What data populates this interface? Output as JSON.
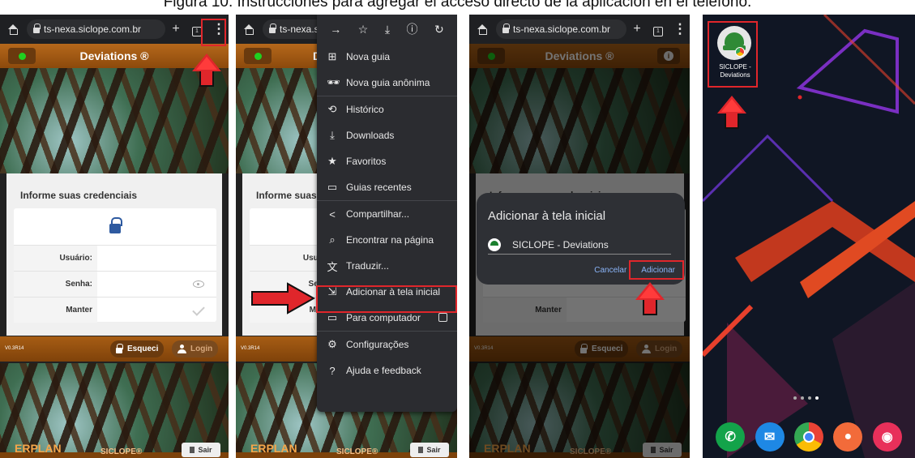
{
  "caption": "Figura 10. Instrucciones para agregar el acceso directo de la aplicación en el teléfono.",
  "browser": {
    "url_full": "ts-nexa.siclope.com.br",
    "url_short": "ts-nexa.s",
    "url_dim": "ts-nexa.siclope.com.br",
    "new_tab": "+",
    "tab_count": "1",
    "menu_dots": "⋮"
  },
  "app": {
    "title": "Deviations ®",
    "prompt": "Informe suas credenciais",
    "user_label": "Usuário:",
    "pass_label": "Senha:",
    "keep_label": "Manter",
    "version": "V0.3R14",
    "forgot_btn": "Esqueci",
    "login_btn": "Login",
    "erplan": "ERPLAN",
    "siclope": "SICLOPE®",
    "exit_btn": "Sair",
    "p2_prompt_short": "Informe suas c",
    "p2_user_short": "Usuári",
    "p2_pass_short": "Senh",
    "p2_keep_short": "Mant"
  },
  "menu": {
    "items": [
      {
        "icon": "⊞",
        "label": "Nova guia"
      },
      {
        "icon": "🕶",
        "label": "Nova guia anônima"
      },
      {
        "icon": "⟲",
        "label": "Histórico"
      },
      {
        "icon": "⤓",
        "label": "Downloads"
      },
      {
        "icon": "★",
        "label": "Favoritos"
      },
      {
        "icon": "▭",
        "label": "Guias recentes"
      },
      {
        "icon": "<",
        "label": "Compartilhar..."
      },
      {
        "icon": "⌕",
        "label": "Encontrar na página"
      },
      {
        "icon": "文",
        "label": "Traduzir..."
      },
      {
        "icon": "⇲",
        "label": "Adicionar à tela inicial"
      },
      {
        "icon": "▭",
        "label": "Para computador"
      },
      {
        "icon": "⚙",
        "label": "Configurações"
      },
      {
        "icon": "?",
        "label": "Ajuda e feedback"
      }
    ]
  },
  "dialog": {
    "title": "Adicionar à tela inicial",
    "app_name": "SICLOPE - Deviations",
    "cancel": "Cancelar",
    "add": "Adicionar"
  },
  "homescreen": {
    "shortcut_line1": "SICLOPE -",
    "shortcut_line2": "Deviations"
  },
  "colors": {
    "accent_red": "#e0262b",
    "app_orange": "#a75d14"
  }
}
